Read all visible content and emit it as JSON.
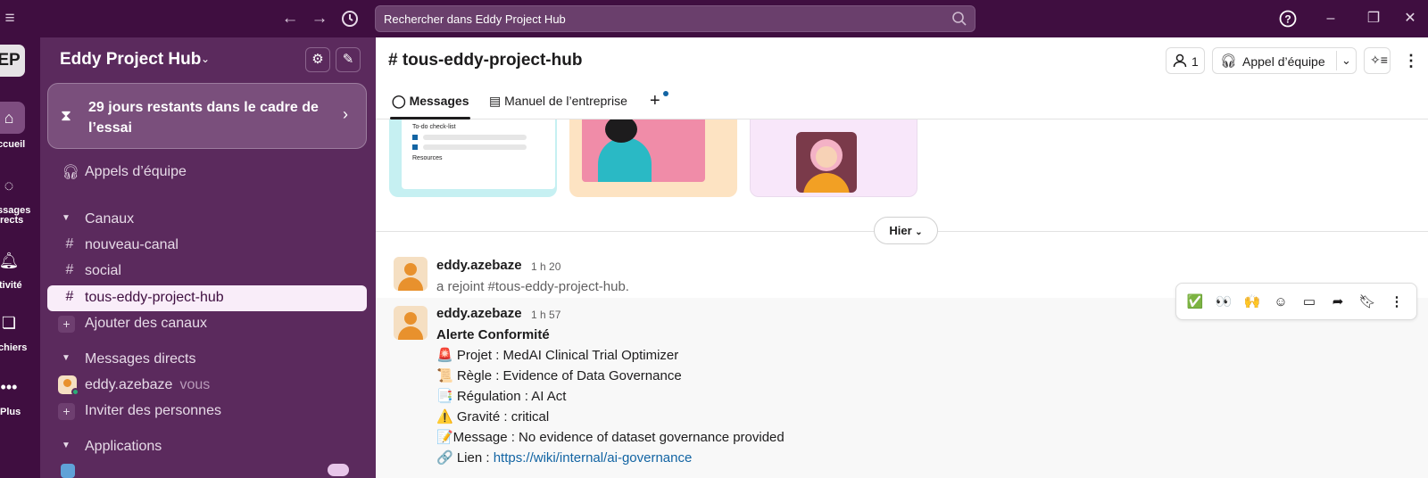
{
  "topbar": {
    "search_placeholder": "Rechercher dans Eddy Project Hub",
    "icons": [
      "menu-icon",
      "back-arrow-icon",
      "forward-arrow-icon",
      "history-icon",
      "search-icon",
      "help-icon",
      "minimize-icon",
      "maximize-icon",
      "close-icon"
    ]
  },
  "rail": {
    "workspace_initials": "EP",
    "items": [
      {
        "label": "ccueil",
        "icon": "home-icon"
      },
      {
        "label": "ssages",
        "label2": "rects",
        "icon": "dm-icon"
      },
      {
        "label": "tivité",
        "icon": "bell-icon"
      },
      {
        "label": "chiers",
        "icon": "files-icon"
      },
      {
        "label": "Plus",
        "icon": "more-icon"
      }
    ]
  },
  "sidebar": {
    "workspace_name": "Eddy Project Hub",
    "trial_text": "29 jours restants dans le cadre de l’essai",
    "huddles_label": "Appels d’équipe",
    "channels_header": "Canaux",
    "channels": [
      "nouveau-canal",
      "social",
      "tous-eddy-project-hub"
    ],
    "add_channels": "Ajouter des canaux",
    "dm_header": "Messages directs",
    "dm_user": "eddy.azebaze",
    "dm_you": "vous",
    "invite": "Inviter des personnes",
    "apps_header": "Applications"
  },
  "channel": {
    "title": "# tous-eddy-project-hub",
    "member_count": "1",
    "huddle_button": "Appel d’équipe",
    "tabs": [
      "Messages",
      "Manuel de l’entreprise"
    ],
    "card_texts": [
      "To-do check-list",
      "Resources"
    ]
  },
  "day_divider": "Hier",
  "messages": [
    {
      "author": "eddy.azebaze",
      "time": "1 h 20",
      "lines": [
        "a rejoint #tous-eddy-project-hub."
      ]
    },
    {
      "author": "eddy.azebaze",
      "time": "1 h 57",
      "heading": "Alerte Conformité",
      "lines": [
        "🚨 Projet : MedAI Clinical Trial Optimizer",
        "📜 Règle : Evidence of Data Governance",
        "📑 Régulation : AI Act",
        "⚠️ Gravité : critical",
        "📝Message : No evidence of dataset governance provided"
      ],
      "link_prefix": "🔗 Lien : ",
      "link": "https://wiki/internal/ai-governance"
    }
  ],
  "toolbar": [
    "✅",
    "👀",
    "🙌",
    "add-reaction-icon",
    "reply-thread-icon",
    "share-icon",
    "bookmark-icon",
    "more-actions-icon"
  ],
  "colors": {
    "aubergine": "#4a154b",
    "sidebar": "#5b2a5d",
    "active_channel": "#f9edf9",
    "link": "#1264a3"
  }
}
